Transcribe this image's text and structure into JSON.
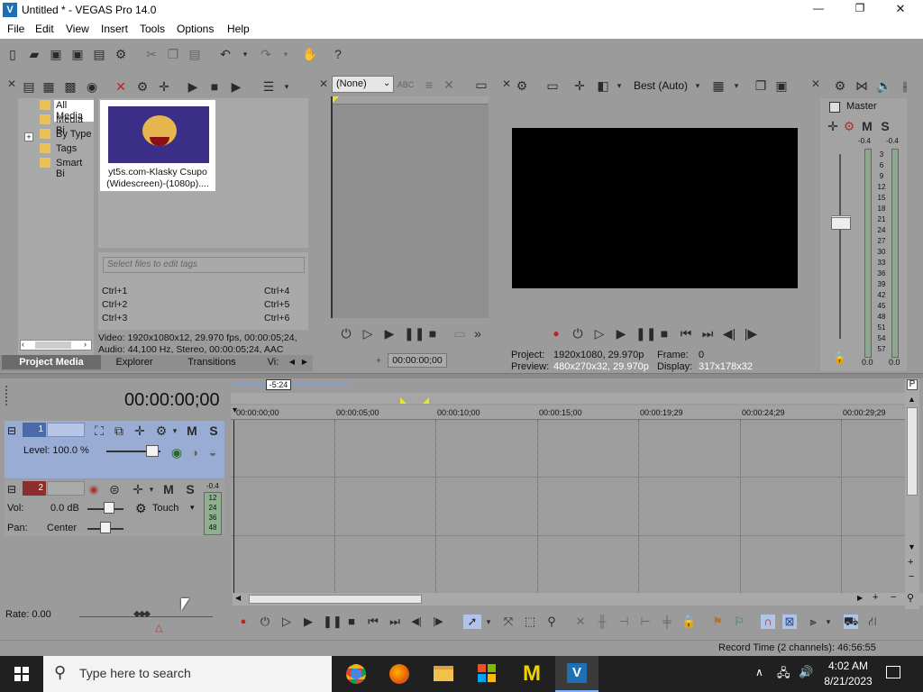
{
  "window": {
    "title": "Untitled * - VEGAS Pro 14.0",
    "min": "—",
    "max": "❐",
    "close": "✕"
  },
  "menu": [
    "File",
    "Edit",
    "View",
    "Insert",
    "Tools",
    "Options",
    "Help"
  ],
  "explorer": {
    "tree": [
      "All Media",
      "Media Bi",
      "By Type",
      "Tags",
      "Smart Bi"
    ],
    "expand": "+",
    "media_name": "yt5s.com-Klasky Csupo (Widescreen)-(1080p)....",
    "tags_placeholder": "Select files to edit tags",
    "shortcuts": [
      [
        "Ctrl+1",
        "Ctrl+4"
      ],
      [
        "Ctrl+2",
        "Ctrl+5"
      ],
      [
        "Ctrl+3",
        "Ctrl+6"
      ]
    ],
    "video_info": "Video: 1920x1080x12, 29.970 fps, 00:00:05;24,",
    "audio_info": "Audio: 44,100 Hz, Stereo, 00:00:05;24, AAC",
    "tabs": [
      "Project Media",
      "Explorer",
      "Transitions",
      "Vi:"
    ]
  },
  "trimmer": {
    "select_value": "(None)",
    "timecode": "00:00:00;00"
  },
  "preview": {
    "quality": "Best (Auto)",
    "project_label": "Project:",
    "project_value": "1920x1080, 29.970p",
    "frame_label": "Frame:",
    "frame_value": "0",
    "preview_label": "Preview:",
    "preview_value": "480x270x32, 29.970p",
    "display_label": "Display:",
    "display_value": "317x178x32"
  },
  "master": {
    "title": "Master",
    "m": "M",
    "s": "S",
    "peak_left": "-0.4",
    "peak_right": "-0.4",
    "scale": [
      "3",
      "6",
      "9",
      "12",
      "15",
      "18",
      "21",
      "24",
      "27",
      "30",
      "33",
      "36",
      "39",
      "42",
      "45",
      "48",
      "51",
      "54",
      "57"
    ],
    "bottom_left": "0.0",
    "bottom_right": "0.0"
  },
  "timeline": {
    "cursor": "00:00:00;00",
    "loop_label": "-5:24",
    "ruler": [
      "00:00:00;00",
      "00:00:05;00",
      "00:00:10;00",
      "00:00:15;00",
      "00:00:19;29",
      "00:00:24;29",
      "00:00:29;29"
    ],
    "rate": "Rate: 0.00",
    "record_time": "Record Time (2 channels): 46:56:55"
  },
  "track1": {
    "number": "1",
    "level": "Level: 100.0 %",
    "m": "M",
    "s": "S"
  },
  "track2": {
    "number": "2",
    "m": "M",
    "s": "S",
    "vol_label": "Vol:",
    "vol_value": "0.0 dB",
    "pan_label": "Pan:",
    "pan_value": "Center",
    "touch": "Touch",
    "peak": "-0.4",
    "meter": [
      "12",
      "24",
      "36",
      "48"
    ]
  },
  "taskbar": {
    "search_placeholder": "Type here to search",
    "time": "4:02 AM",
    "date": "8/21/2023"
  }
}
